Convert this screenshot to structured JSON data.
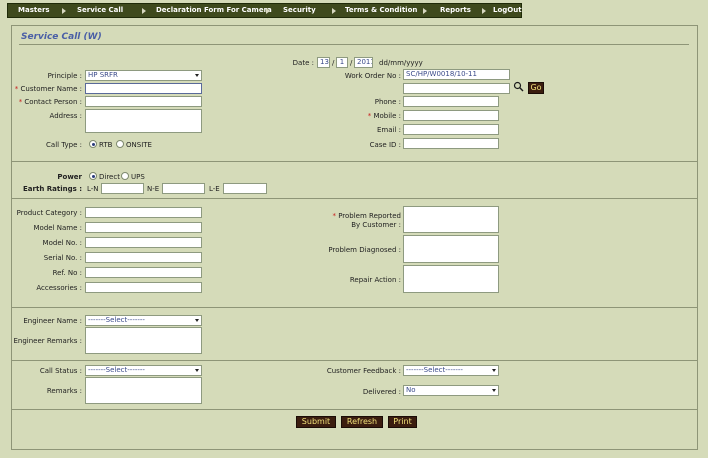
{
  "menu": [
    {
      "label": "Masters"
    },
    {
      "label": "Service Call"
    },
    {
      "label": "Declaration Form For Camera"
    },
    {
      "label": "Security"
    },
    {
      "label": "Terms & Condition"
    },
    {
      "label": "Reports"
    },
    {
      "label": "LogOut"
    }
  ],
  "form": {
    "title": "Service Call (W)",
    "date": {
      "label": "Date :",
      "day": "13",
      "month": "1",
      "year": "2011",
      "sep": "/",
      "format": "dd/mm/yyyy"
    },
    "principle": {
      "label": "Principle :",
      "value": "HP SRFR"
    },
    "work_order": {
      "label": "Work Order No :",
      "value": "SC/HP/W0018/10-11"
    },
    "customer_name": {
      "label": "Customer Name :",
      "value": ""
    },
    "contact_person": {
      "label": "Contact Person :",
      "value": ""
    },
    "phone": {
      "label": "Phone :",
      "value": ""
    },
    "address": {
      "label": "Address :"
    },
    "mobile": {
      "label": "Mobile :",
      "value": ""
    },
    "email": {
      "label": "Email :",
      "value": ""
    },
    "call_type": {
      "label": "Call Type :",
      "options": [
        "RTB",
        "ONSITE"
      ],
      "selected": "RTB"
    },
    "case_id": {
      "label": "Case ID :",
      "value": ""
    },
    "go_label": "Go",
    "required_mark": "*",
    "power": {
      "label": "Power",
      "options": [
        "Direct",
        "UPS"
      ],
      "selected": "Direct"
    },
    "earth": {
      "label": "Earth Ratings :",
      "ln": "L-N",
      "ne": "N-E",
      "le": "L-E"
    },
    "product_category": {
      "label": "Product Category :"
    },
    "model_name": {
      "label": "Model Name :"
    },
    "model_no": {
      "label": "Model No. :"
    },
    "serial_no": {
      "label": "Serial No. :"
    },
    "ref_no": {
      "label": "Ref. No :"
    },
    "accessories": {
      "label": "Accessories :"
    },
    "problem_reported": {
      "label1": "Problem Reported",
      "label2": "By Customer :"
    },
    "problem_diagnosed": {
      "label": "Problem Diagnosed :"
    },
    "repair_action": {
      "label": "Repair Action :"
    },
    "engineer_name": {
      "label": "Engineer Name :",
      "value": "-------Select-------"
    },
    "engineer_remarks": {
      "label": "Engineer Remarks :"
    },
    "call_status": {
      "label": "Call Status :",
      "value": "-------Select-------"
    },
    "customer_feedback": {
      "label": "Customer Feedback :",
      "value": "-------Select-------"
    },
    "remarks": {
      "label": "Remarks :"
    },
    "delivered": {
      "label": "Delivered :",
      "value": "No"
    }
  },
  "buttons": {
    "submit": "Submit",
    "refresh": "Refresh",
    "print": "Print"
  },
  "colors": {
    "menubar": "#3f4a1d",
    "background": "#d5dbb9",
    "title": "#4a5fa6",
    "button": "#3b1d0f",
    "button_text": "#f2e27a",
    "required": "#c81b1b"
  }
}
